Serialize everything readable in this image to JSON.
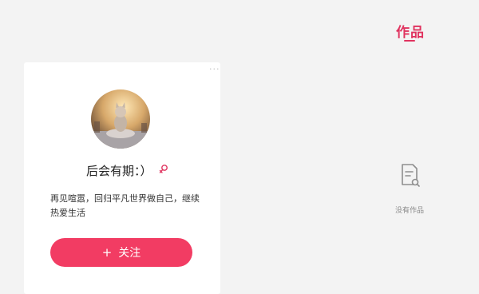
{
  "tabs": {
    "works_label": "作品"
  },
  "empty_state": {
    "icon": "document-search-icon",
    "text": "没有作品"
  },
  "profile": {
    "nickname": "后会有期：）",
    "gender_icon": "female-icon",
    "bio": "再见喧嚣，回归平凡世界做自己，继续热爱生活",
    "follow_icon": "+",
    "follow_label": "关注",
    "more_icon": "···"
  },
  "colors": {
    "accent": "#e0335f",
    "follow_button": "#f23c63",
    "background": "#f3f3f3"
  }
}
